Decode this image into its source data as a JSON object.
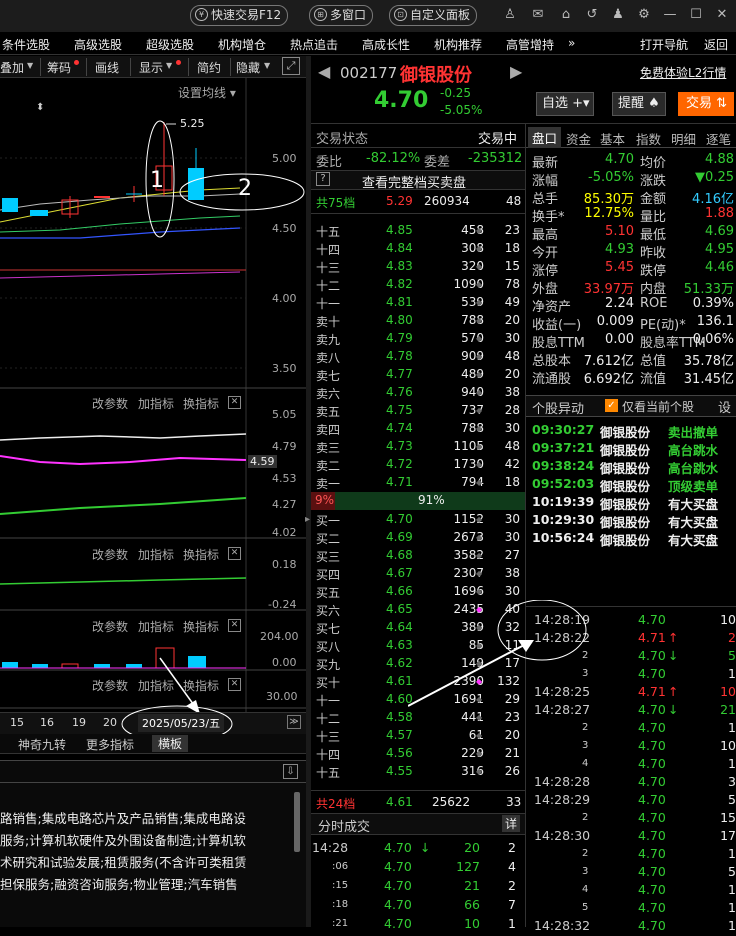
{
  "topbar": {
    "quick_trade": "快速交易F12",
    "multi_window": "多窗口",
    "custom_panel": "自定义面板"
  },
  "menu": {
    "items": [
      "条件选股",
      "高级选股",
      "超级选股",
      "机构增仓",
      "热点追击",
      "高成长性",
      "机构推荐",
      "高管增持"
    ],
    "more": "»",
    "open_nav": "打开导航",
    "back": "返回"
  },
  "left_toolbar": {
    "items": [
      "叠加",
      "筹码",
      "画线",
      "显示",
      "简约",
      "隐藏"
    ]
  },
  "kline": {
    "ma_setting": "设置均线",
    "high_label": "5.25",
    "price_ticks": [
      "5.00",
      "4.50",
      "4.00",
      "3.50"
    ],
    "annot1": "1",
    "annot2": "2"
  },
  "sub1": {
    "params": "改参数",
    "add": "加指标",
    "switch": "换指标",
    "ticks": [
      "5.05",
      "4.79",
      "4.59",
      "4.53",
      "4.27",
      "4.02"
    ]
  },
  "sub2": {
    "params": "改参数",
    "add": "加指标",
    "switch": "换指标",
    "ticks": [
      "0.18",
      "-0.24"
    ]
  },
  "sub3": {
    "params": "改参数",
    "add": "加指标",
    "switch": "换指标",
    "ticks": [
      "204.00",
      "0.00"
    ]
  },
  "sub4": {
    "params": "改参数",
    "add": "加指标",
    "switch": "换指标",
    "ticks": [
      "30.00"
    ]
  },
  "dates": {
    "items": [
      "15",
      "16",
      "19",
      "20"
    ],
    "current": "2025/05/23/五"
  },
  "bottom_tabs": [
    "神奇九转",
    "更多指标",
    "横板"
  ],
  "business": [
    "路销售;集成电路芯片及产品销售;集成电路设",
    "服务;计算机软硬件及外围设备制造;计算机软",
    "术研究和试验发展;租赁服务(不含许可类租赁",
    "担保服务;融资咨询服务;物业管理;汽车销售"
  ],
  "stock": {
    "code": "002177",
    "name": "御银股份",
    "price": "4.70",
    "change": "-0.25",
    "pct": "-5.05%",
    "free_l2": "免费体验L2行情",
    "fav": "自选",
    "alert": "提醒",
    "trade": "交易"
  },
  "orderbook": {
    "status": "交易状态",
    "status_val": "交易中",
    "wb_label": "委比",
    "wb": "-82.12%",
    "wc_label": "委差",
    "wc": "-235312",
    "full": "查看完整档买卖盘",
    "sell_total": {
      "label": "共75档",
      "price": "5.29",
      "vol": "260934",
      "n": "48"
    },
    "asks": [
      [
        "十五",
        "4.85",
        "458",
        "23"
      ],
      [
        "十四",
        "4.84",
        "308",
        "18"
      ],
      [
        "十三",
        "4.83",
        "320",
        "15"
      ],
      [
        "十二",
        "4.82",
        "1090",
        "78"
      ],
      [
        "十一",
        "4.81",
        "539",
        "49"
      ],
      [
        "卖十",
        "4.80",
        "788",
        "20"
      ],
      [
        "卖九",
        "4.79",
        "570",
        "30"
      ],
      [
        "卖八",
        "4.78",
        "909",
        "48"
      ],
      [
        "卖七",
        "4.77",
        "489",
        "20"
      ],
      [
        "卖六",
        "4.76",
        "940",
        "38"
      ],
      [
        "卖五",
        "4.75",
        "737",
        "28"
      ],
      [
        "卖四",
        "4.74",
        "788",
        "30"
      ],
      [
        "卖三",
        "4.73",
        "1105",
        "48"
      ],
      [
        "卖二",
        "4.72",
        "1730",
        "42"
      ],
      [
        "卖一",
        "4.71",
        "794",
        "18"
      ]
    ],
    "ratio_sell": "9%",
    "ratio_buy": "91%",
    "bids": [
      [
        "买一",
        "4.70",
        "1152",
        "30"
      ],
      [
        "买二",
        "4.69",
        "2673",
        "30"
      ],
      [
        "买三",
        "4.68",
        "3582",
        "27"
      ],
      [
        "买四",
        "4.67",
        "2307",
        "38"
      ],
      [
        "买五",
        "4.66",
        "1696",
        "30"
      ],
      [
        "买六",
        "4.65",
        "2435",
        "40"
      ],
      [
        "买七",
        "4.64",
        "389",
        "32"
      ],
      [
        "买八",
        "4.63",
        "85",
        "11"
      ],
      [
        "买九",
        "4.62",
        "149",
        "17"
      ],
      [
        "买十",
        "4.61",
        "2390",
        "132"
      ],
      [
        "十一",
        "4.60",
        "1691",
        "29"
      ],
      [
        "十二",
        "4.58",
        "441",
        "23"
      ],
      [
        "十三",
        "4.57",
        "61",
        "20"
      ],
      [
        "十四",
        "4.56",
        "229",
        "21"
      ],
      [
        "十五",
        "4.55",
        "316",
        "26"
      ]
    ],
    "buy_total": {
      "label": "共24档",
      "price": "4.61",
      "vol": "25622",
      "n": "33"
    }
  },
  "minute_trades": {
    "title": "分时成交",
    "detail": "详",
    "rows": [
      [
        "14:28",
        "4.70",
        "20",
        "2"
      ],
      [
        ":06",
        "4.70",
        "127",
        "4"
      ],
      [
        ":15",
        "4.70",
        "21",
        "2"
      ],
      [
        ":18",
        "4.70",
        "66",
        "7"
      ],
      [
        ":21",
        "4.70",
        "10",
        "1"
      ]
    ]
  },
  "tabs": [
    "盘口",
    "资金",
    "基本",
    "指数",
    "明细",
    "逐笔"
  ],
  "stats": [
    [
      "最新",
      "4.70",
      "均价",
      "4.88"
    ],
    [
      "涨幅",
      "-5.05%",
      "涨跌",
      "▼0.25"
    ],
    [
      "总手",
      "85.30万",
      "金额",
      "4.16亿"
    ],
    [
      "换手*",
      "12.75%",
      "量比",
      "1.88"
    ],
    [
      "最高",
      "5.10",
      "最低",
      "4.69"
    ],
    [
      "今开",
      "4.93",
      "昨收",
      "4.95"
    ],
    [
      "涨停",
      "5.45",
      "跌停",
      "4.46"
    ],
    [
      "外盘",
      "33.97万",
      "内盘",
      "51.33万"
    ],
    [
      "净资产",
      "2.24",
      "ROE",
      "0.39%"
    ],
    [
      "收益(一)",
      "0.009",
      "PE(动)*",
      "136.1"
    ],
    [
      "股息TTM",
      "0.00",
      "股息率TTM",
      "0.06%"
    ],
    [
      "总股本",
      "7.612亿",
      "总值",
      "35.78亿"
    ],
    [
      "流通股",
      "6.692亿",
      "流值",
      "31.45亿"
    ]
  ],
  "events": {
    "title": "个股异动",
    "only_current": "仅看当前个股",
    "settings": "设",
    "rows": [
      [
        "09:30:27",
        "御银股份",
        "卖出撤单"
      ],
      [
        "09:37:21",
        "御银股份",
        "高台跳水"
      ],
      [
        "09:38:24",
        "御银股份",
        "高台跳水"
      ],
      [
        "09:52:03",
        "御银股份",
        "顶级卖单"
      ],
      [
        "10:19:39",
        "御银股份",
        "有大买盘"
      ],
      [
        "10:29:30",
        "御银股份",
        "有大买盘"
      ],
      [
        "10:56:24",
        "御银股份",
        "有大买盘"
      ]
    ]
  },
  "ticks": [
    [
      "14:28:19",
      "4.70",
      "",
      "10"
    ],
    [
      "14:28:22",
      "4.71",
      "↑",
      "2"
    ],
    [
      "2",
      "4.70",
      "↓",
      "5"
    ],
    [
      "3",
      "4.70",
      "",
      "1"
    ],
    [
      "14:28:25",
      "4.71",
      "↑",
      "10"
    ],
    [
      "14:28:27",
      "4.70",
      "↓",
      "21"
    ],
    [
      "2",
      "4.70",
      "",
      "1"
    ],
    [
      "3",
      "4.70",
      "",
      "10"
    ],
    [
      "4",
      "4.70",
      "",
      "1"
    ],
    [
      "14:28:28",
      "4.70",
      "",
      "3"
    ],
    [
      "14:28:29",
      "4.70",
      "",
      "5"
    ],
    [
      "2",
      "4.70",
      "",
      "15"
    ],
    [
      "14:28:30",
      "4.70",
      "",
      "17"
    ],
    [
      "2",
      "4.70",
      "",
      "1"
    ],
    [
      "3",
      "4.70",
      "",
      "5"
    ],
    [
      "4",
      "4.70",
      "",
      "1"
    ],
    [
      "5",
      "4.70",
      "",
      "1"
    ],
    [
      "14:28:32",
      "4.70",
      "",
      "1"
    ]
  ],
  "colors": {
    "up": "#ff3333",
    "down": "#33cc33",
    "accent": "#ff6600"
  }
}
